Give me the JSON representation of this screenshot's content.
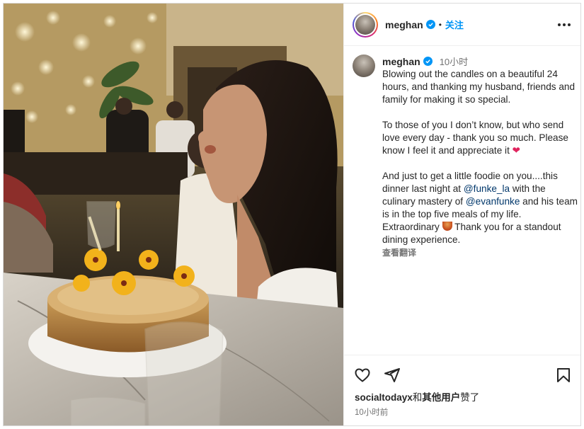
{
  "post": {
    "username": "meghan",
    "dot": "•",
    "follow_label": "关注",
    "caption": {
      "username": "meghan",
      "time_ago": "10小时",
      "paragraph1": "Blowing out the candles on a beautiful 24 hours, and thanking my husband, friends and family for making it so special.",
      "paragraph2": "To those of you I don’t know, but who send love every day - thank you so much. Please know I feel it and appreciate it",
      "paragraph3_a": "And just to get a little foodie on you....this dinner last night at ",
      "mention1": "@funke_la",
      "paragraph3_b": " with the culinary mastery of ",
      "mention2": "@evanfunke",
      "paragraph3_c": " and his team is in the top five meals of my life. Extraordinary ",
      "paragraph3_d": " Thank you for a standout dining experience.",
      "translate_label": "查看翻译"
    },
    "likes": {
      "liker": "socialtodayx",
      "connector": "和",
      "others": "其他用户",
      "suffix": "赞了"
    },
    "timestamp": "10小时前"
  },
  "icons": {
    "more": "more-options-icon",
    "like": "heart-icon",
    "share": "paper-plane-icon",
    "save": "bookmark-icon",
    "verified": "verified-badge-icon"
  },
  "colors": {
    "accent": "#0095f6",
    "mention": "#00376b",
    "muted": "#737373",
    "heart_emoji": "#e0245e"
  }
}
